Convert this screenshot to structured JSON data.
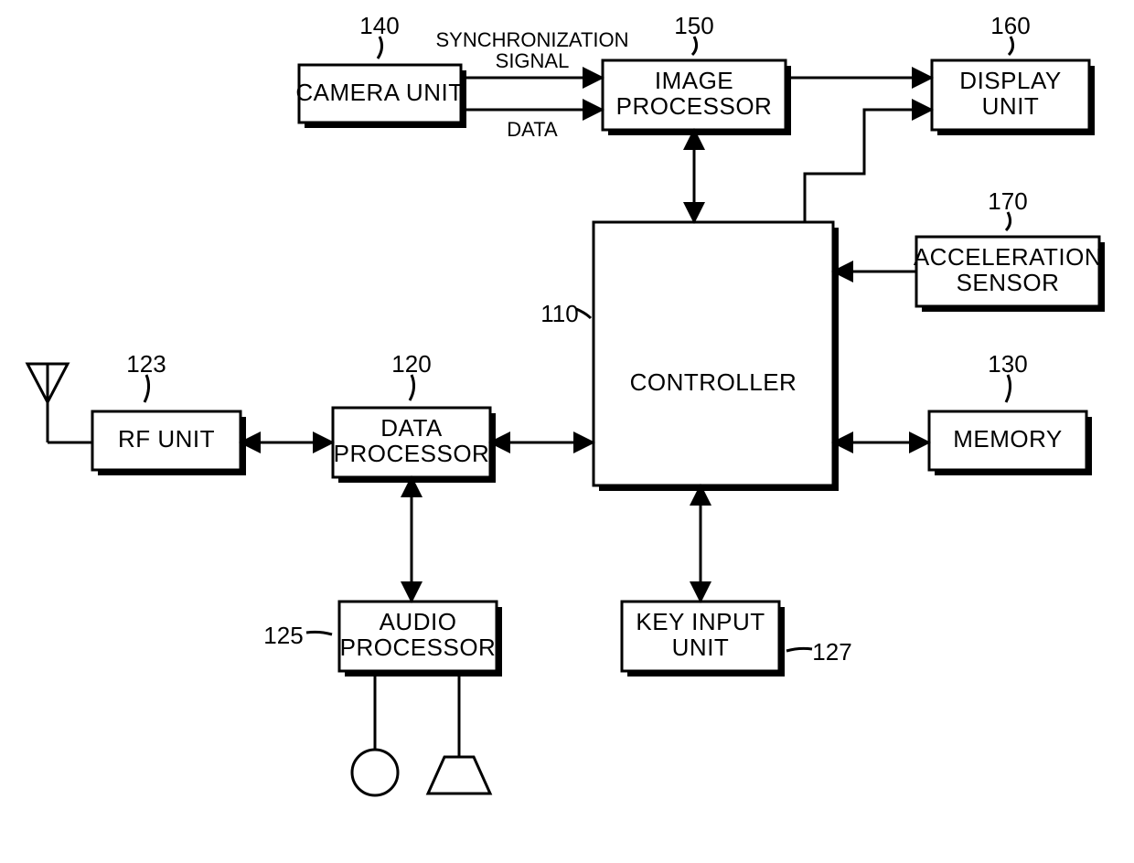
{
  "blocks": {
    "camera": {
      "label1": "CAMERA UNIT",
      "label2": "",
      "ref": "140"
    },
    "image": {
      "label1": "IMAGE",
      "label2": "PROCESSOR",
      "ref": "150"
    },
    "display": {
      "label1": "DISPLAY",
      "label2": "UNIT",
      "ref": "160"
    },
    "accel": {
      "label1": "ACCELERATION",
      "label2": "SENSOR",
      "ref": "170"
    },
    "controller": {
      "label1": "CONTROLLER",
      "label2": "",
      "ref": "110"
    },
    "rf": {
      "label1": "RF UNIT",
      "label2": "",
      "ref": "123"
    },
    "data": {
      "label1": "DATA",
      "label2": "PROCESSOR",
      "ref": "120"
    },
    "memory": {
      "label1": "MEMORY",
      "label2": "",
      "ref": "130"
    },
    "audio": {
      "label1": "AUDIO",
      "label2": "PROCESSOR",
      "ref": "125"
    },
    "key": {
      "label1": "KEY INPUT",
      "label2": "UNIT",
      "ref": "127"
    }
  },
  "signals": {
    "sync1": "SYNCHRONIZATION",
    "sync2": "SIGNAL",
    "data": "DATA"
  }
}
